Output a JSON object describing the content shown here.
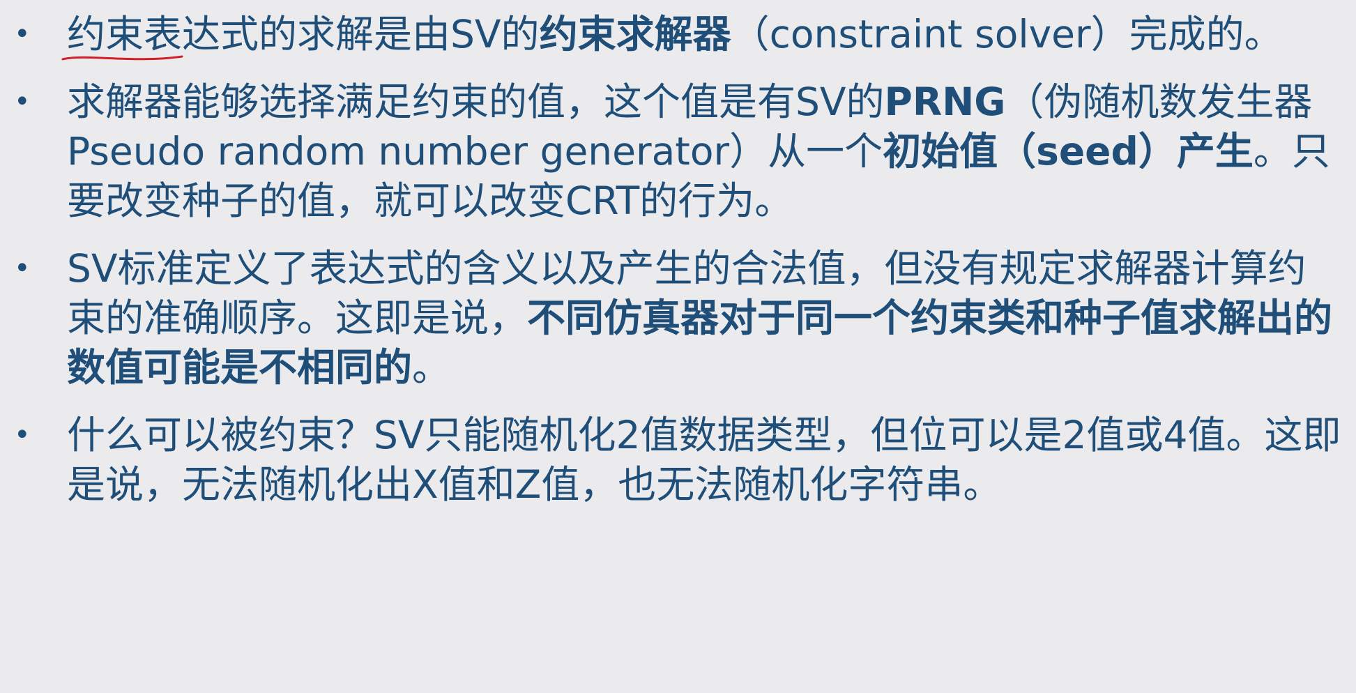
{
  "bullets": [
    {
      "segments": [
        {
          "text": "约束表",
          "bold": false,
          "underline": true
        },
        {
          "text": "达式的求解是由SV的",
          "bold": false
        },
        {
          "text": "约束求解器",
          "bold": true
        },
        {
          "text": "（constraint solver）完成的。",
          "bold": false
        }
      ]
    },
    {
      "segments": [
        {
          "text": "求解器能够选择满足约束的值，这个值是有SV的",
          "bold": false
        },
        {
          "text": "PRNG",
          "bold": true
        },
        {
          "text": "（伪随机数发生器 Pseudo random number generator）从一个",
          "bold": false
        },
        {
          "text": "初始值（seed）产生",
          "bold": true
        },
        {
          "text": "。只要改变种子的值，就可以改变CRT的行为。",
          "bold": false
        }
      ]
    },
    {
      "segments": [
        {
          "text": "SV标准定义了表达式的含义以及产生的合法值，但没有规定求解器计算约束的准确顺序。这即是说，",
          "bold": false
        },
        {
          "text": "不同仿真器对于同一个约束类和种子值求解出的数值可能是不相同的",
          "bold": true
        },
        {
          "text": "。",
          "bold": false
        }
      ]
    },
    {
      "segments": [
        {
          "text": "什么可以被约束？SV只能随机化2值数据类型，但位可以是2值或4值。这即是说，无法随机化出X值和Z值，也无法随机化字符串。",
          "bold": false
        }
      ]
    }
  ],
  "colors": {
    "text": "#1f4e79",
    "background": "#ebebee",
    "annotation": "#d0202a"
  },
  "bullet_symbol": "•"
}
